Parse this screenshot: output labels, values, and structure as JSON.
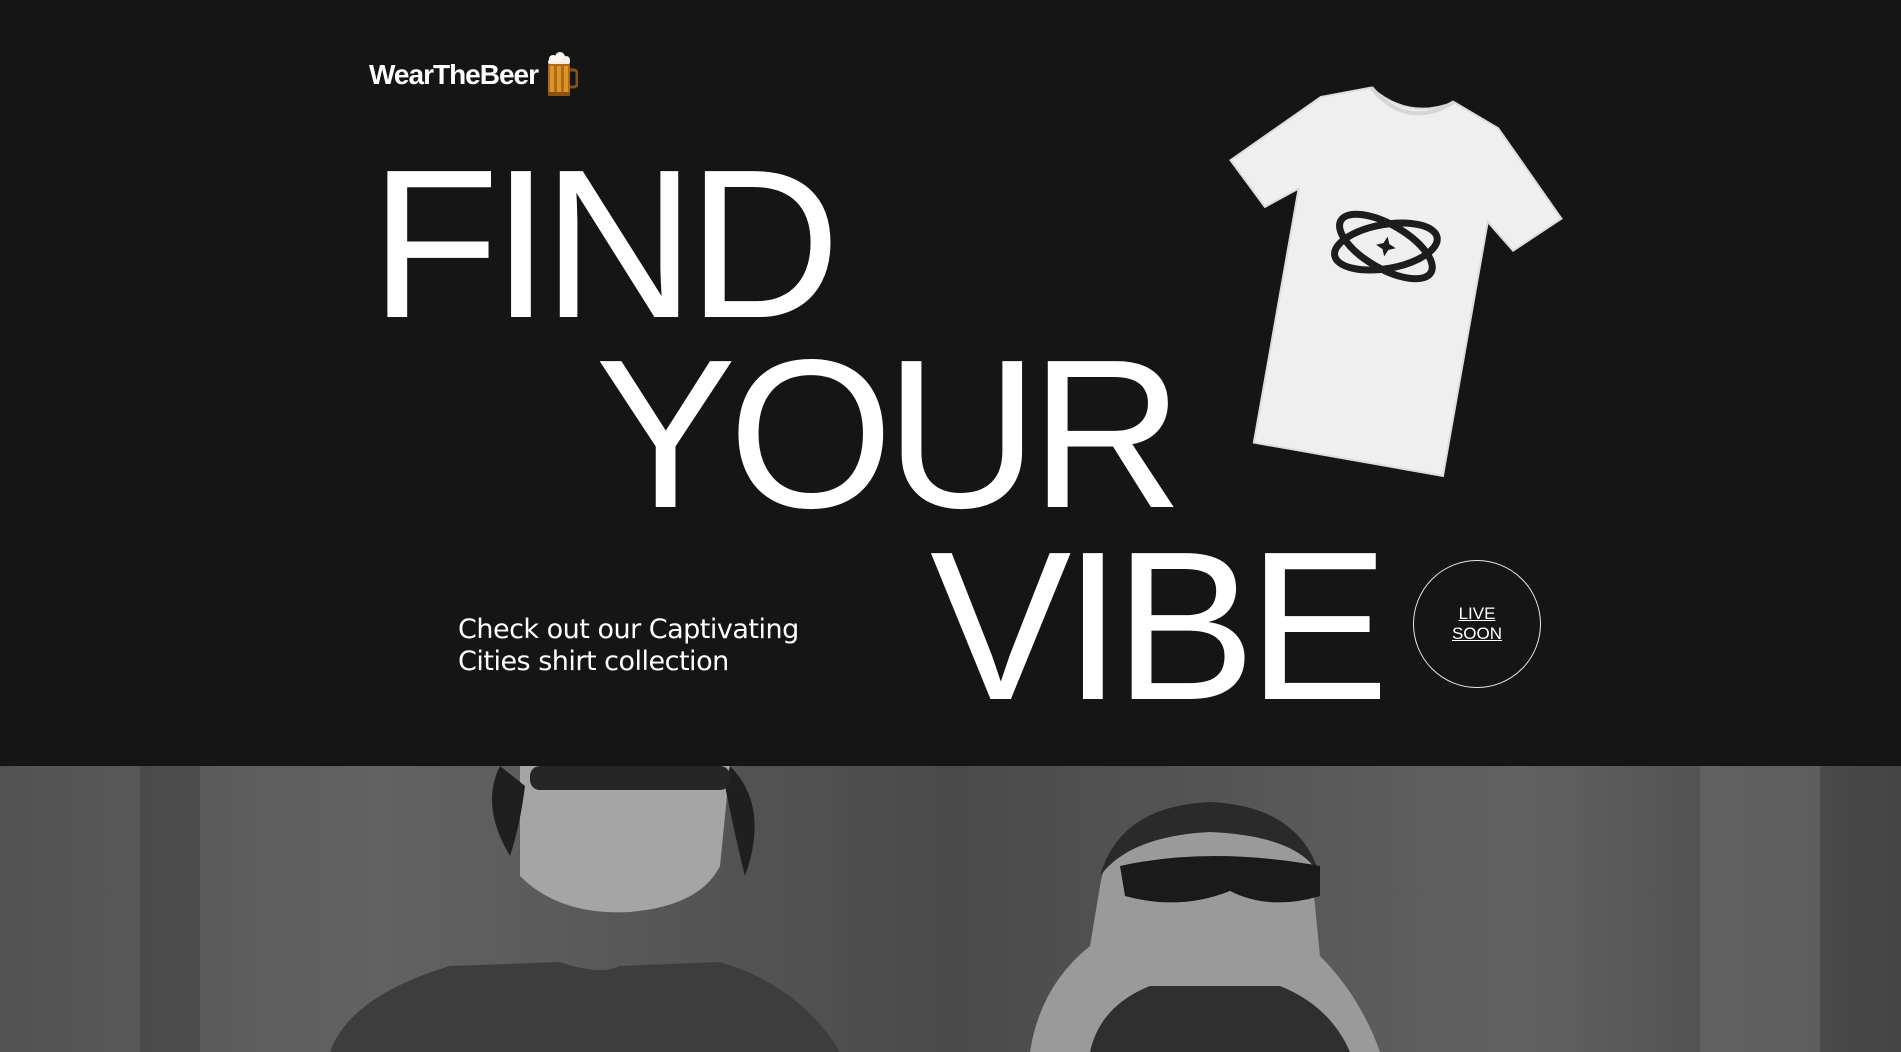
{
  "brand": {
    "name": "WearTheBeer",
    "logo_icon": "beer-mug-icon"
  },
  "hero": {
    "headline": [
      "FIND",
      "YOUR",
      "VIBE"
    ],
    "tagline": "Check out our Captivating Cities shirt collection",
    "cta_label": "LIVE SOON",
    "product_image": "white-tshirt-atom-print",
    "background_color": "#151515"
  },
  "photo_section": {
    "image": "two-models-sunglasses-bw"
  }
}
